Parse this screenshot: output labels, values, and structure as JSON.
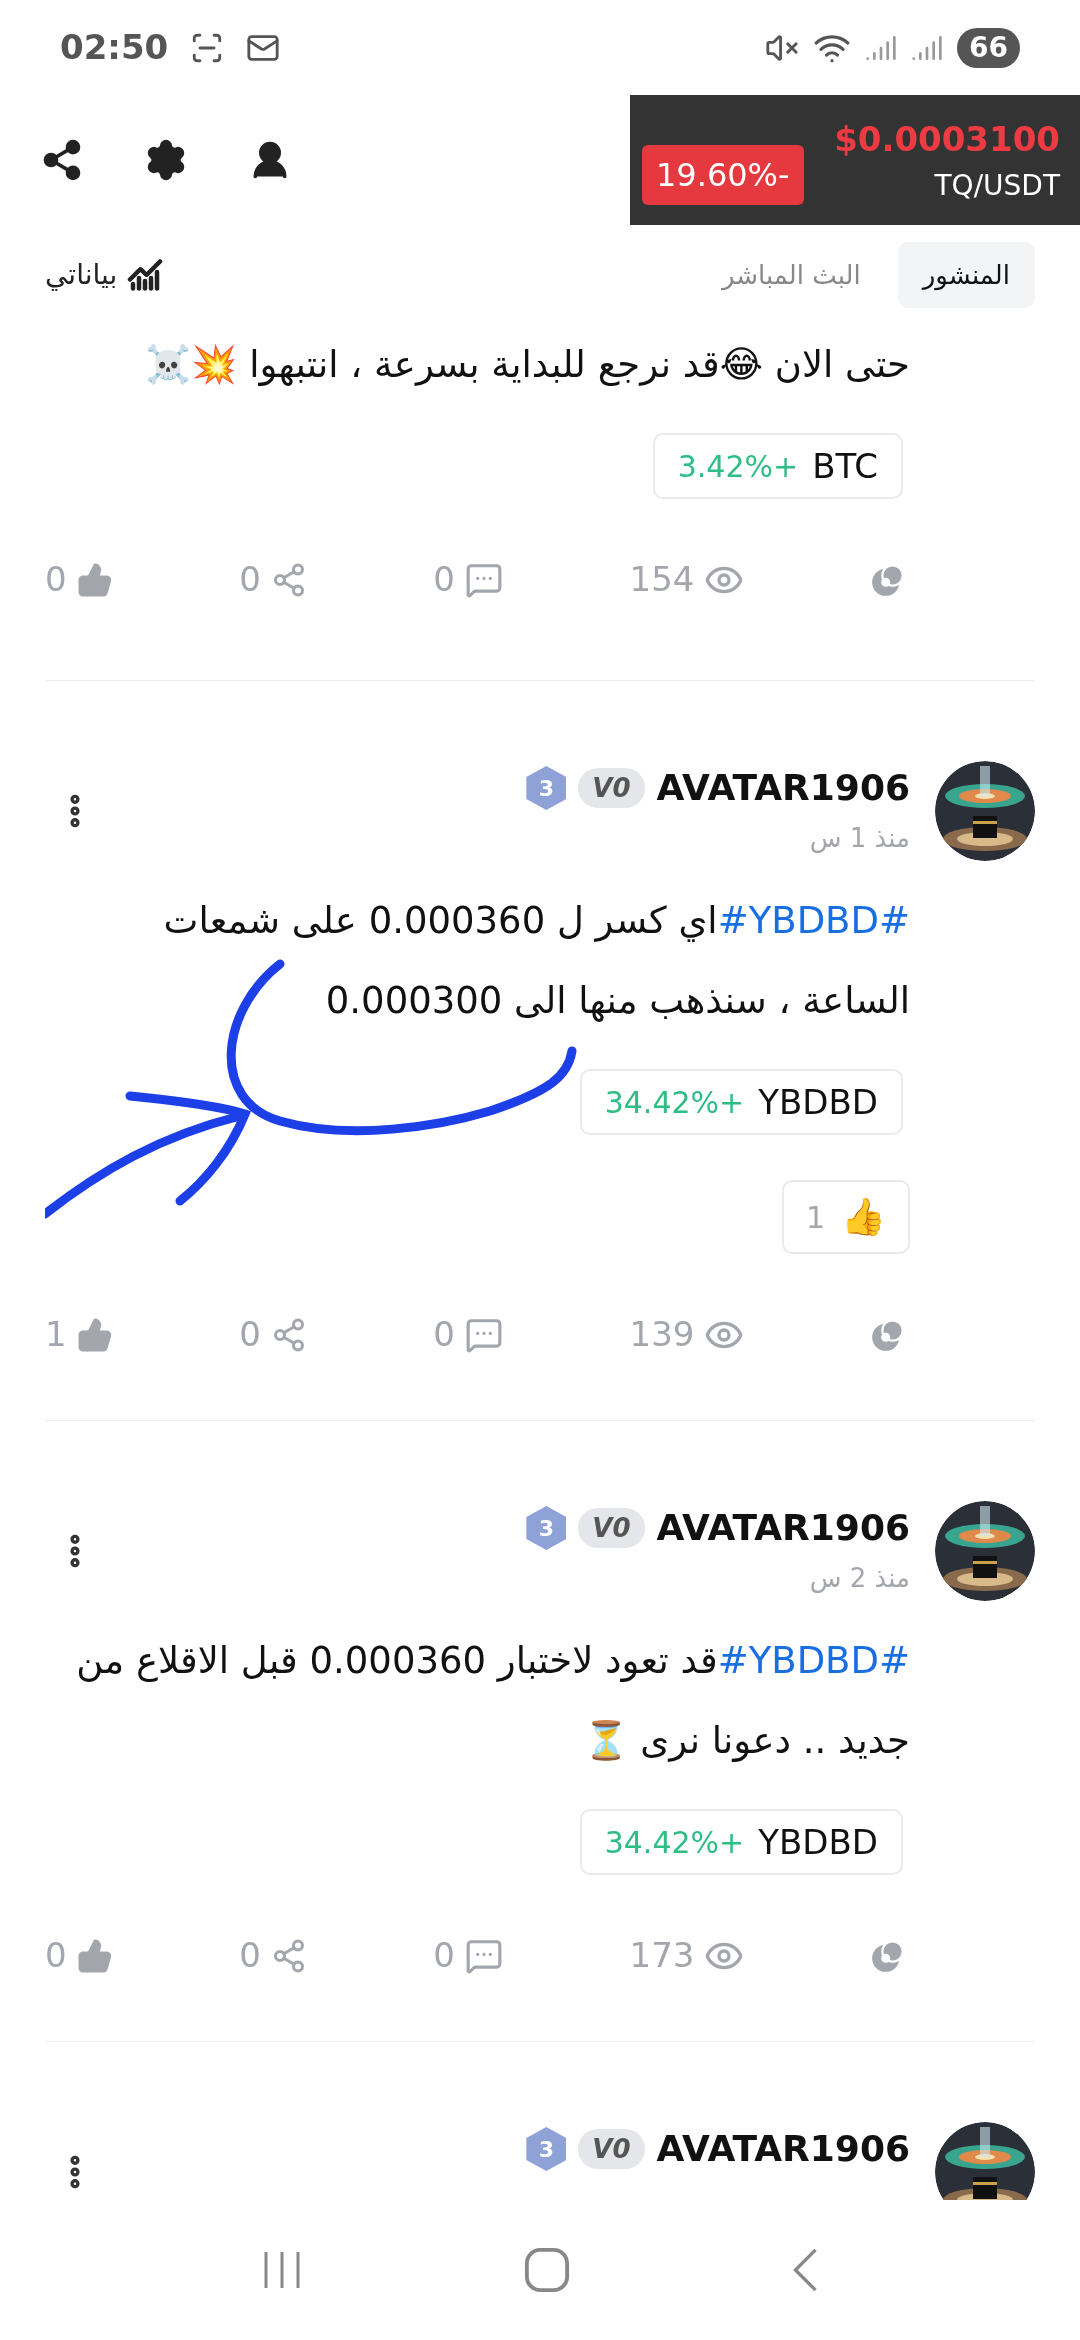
{
  "status_bar": {
    "time": "02:50",
    "battery": "66"
  },
  "ticker": {
    "price": "$0.0003100",
    "pair": "TQ/USDT",
    "change": "19.60%-"
  },
  "tabs": [
    {
      "label": "المنشور",
      "selected": true
    },
    {
      "label": "البث المباشر",
      "selected": false
    }
  ],
  "my_data_link": "بياناتي",
  "posts": [
    {
      "text": "حتى الان 😂قد نرجع للبداية بسرعة ، انتبهوا 💥☠️",
      "token": {
        "symbol": "BTC",
        "change": "3.42%+"
      },
      "stats": {
        "likes": "0",
        "shares": "0",
        "comments": "0",
        "views": "154"
      }
    },
    {
      "author": "AVATAR1906",
      "level": "3",
      "vip": "V0",
      "time": "منذ 1 س",
      "hashtag": "#YBDBD#",
      "text": "اي كسر ل 0.000360 على شمعات الساعة ، سنذهب منها الى 0.000300",
      "token": {
        "symbol": "YBDBD",
        "change": "34.42%+"
      },
      "reaction": {
        "emoji": "👍",
        "count": "1"
      },
      "scribble": true,
      "stats": {
        "likes": "1",
        "shares": "0",
        "comments": "0",
        "views": "139"
      }
    },
    {
      "author": "AVATAR1906",
      "level": "3",
      "vip": "V0",
      "time": "منذ 2 س",
      "hashtag": "#YBDBD#",
      "text": "قد تعود لاختبار 0.000360 قبل الاقلاع من جديد .. دعونا نرى ⏳",
      "token": {
        "symbol": "YBDBD",
        "change": "34.42%+"
      },
      "stats": {
        "likes": "0",
        "shares": "0",
        "comments": "0",
        "views": "173"
      }
    },
    {
      "author": "AVATAR1906",
      "level": "3",
      "vip": "V0"
    }
  ]
}
